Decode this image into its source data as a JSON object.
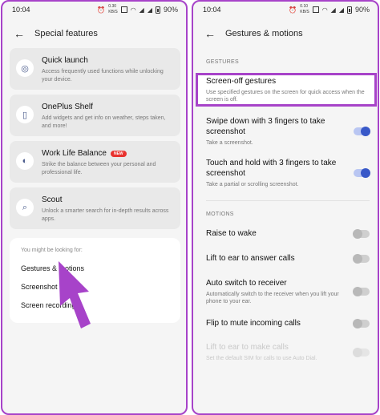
{
  "left": {
    "status": {
      "time": "10:04",
      "net_speed": "0.30\nKB/S",
      "battery": "90%"
    },
    "header": {
      "title": "Special features"
    },
    "cards": [
      {
        "title": "Quick launch",
        "subtitle": "Access frequently used functions while unlocking your device.",
        "icon": "fingerprint-icon"
      },
      {
        "title": "OnePlus Shelf",
        "subtitle": "Add widgets and get info on weather, steps taken, and more!",
        "icon": "phone-icon"
      },
      {
        "title": "Work Life Balance",
        "badge": "NEW",
        "subtitle": "Strike the balance between your personal and professional life.",
        "icon": "balance-icon"
      },
      {
        "title": "Scout",
        "subtitle": "Unlock a smarter search for in-depth results across apps.",
        "icon": "search-icon"
      }
    ],
    "suggestions": {
      "hint": "You might be looking for:",
      "items": [
        "Gestures & motions",
        "Screenshot",
        "Screen recording"
      ]
    }
  },
  "right": {
    "status": {
      "time": "10:04",
      "net_speed": "0.10\nKB/S",
      "battery": "90%"
    },
    "header": {
      "title": "Gestures & motions"
    },
    "gestures_label": "GESTURES",
    "gestures": [
      {
        "title": "Screen-off gestures",
        "subtitle": "Use specified gestures on the screen for quick access when the screen is off."
      },
      {
        "title": "Swipe down with 3 fingers to take screenshot",
        "subtitle": "Take a screenshot.",
        "on": true
      },
      {
        "title": "Touch and hold with 3 fingers to take screenshot",
        "subtitle": "Take a partial or scrolling screenshot.",
        "on": true
      }
    ],
    "motions_label": "MOTIONS",
    "motions": [
      {
        "title": "Raise to wake",
        "on": false
      },
      {
        "title": "Lift to ear to answer calls",
        "on": false
      },
      {
        "title": "Auto switch to receiver",
        "subtitle": "Automatically switch to the receiver when you lift your phone to your ear.",
        "on": false
      },
      {
        "title": "Flip to mute incoming calls",
        "on": false
      },
      {
        "title": "Lift to ear to make calls",
        "subtitle": "Set the default SIM for calls to use Auto Dial.",
        "on": false,
        "disabled": true
      }
    ]
  },
  "colors": {
    "highlight": "#a743c9",
    "toggle_on": "#3858c8",
    "badge": "#e8322e"
  }
}
